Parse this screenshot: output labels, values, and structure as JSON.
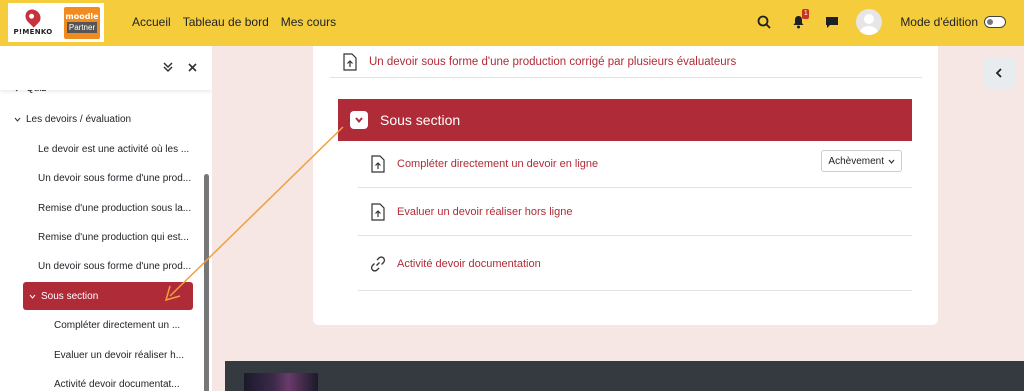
{
  "navbar": {
    "logo_brand": "P!MENKO",
    "logo_partner_top": "moodle",
    "logo_partner_bottom": "Partner",
    "links": [
      "Accueil",
      "Tableau de bord",
      "Mes cours"
    ],
    "notification_count": "1",
    "edit_mode_label": "Mode d'édition",
    "edit_mode_on": false,
    "accent_color": "#f5cd3c"
  },
  "drawer": {
    "items": [
      {
        "label": "Quiz"
      },
      {
        "label": "Les devoirs / évaluation"
      },
      {
        "label": "Le devoir est une activité où les ..."
      },
      {
        "label": "Un devoir sous forme d'une prod..."
      },
      {
        "label": "Remise d'une production sous la..."
      },
      {
        "label": "Remise d'une production qui est..."
      },
      {
        "label": "Un devoir sous forme d'une prod..."
      },
      {
        "label": "Sous section"
      },
      {
        "label": "Compléter directement un ..."
      },
      {
        "label": "Evaluer un devoir réaliser h..."
      },
      {
        "label": "Activité devoir documentat..."
      }
    ]
  },
  "main": {
    "top_activity": "Un devoir sous forme d'une production corrigé par plusieurs évaluateurs",
    "section_title": "Sous section",
    "activities": [
      {
        "label": "Compléter directement un devoir en ligne",
        "icon": "assignment-icon",
        "completion": "Achèvement"
      },
      {
        "label": "Evaluer un devoir réaliser hors ligne",
        "icon": "assignment-icon"
      },
      {
        "label": "Activité devoir documentation",
        "icon": "link-icon"
      }
    ],
    "section_color": "#b02b38"
  }
}
